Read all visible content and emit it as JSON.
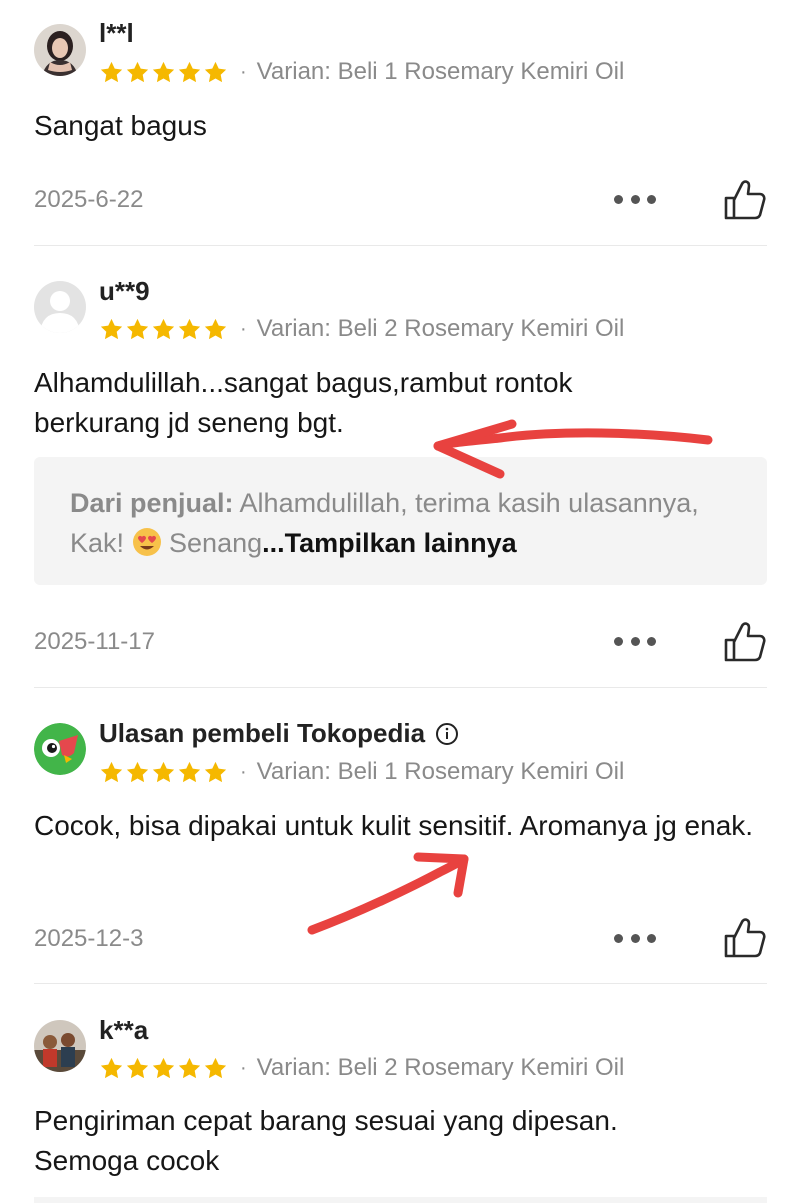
{
  "reviews": [
    {
      "username": "l**l",
      "variant": "Varian: Beli 1 Rosemary Kemiri Oil",
      "rating": 5,
      "text": "Sangat bagus",
      "date": "2025-6-22",
      "avatar": "user-photo-woman"
    },
    {
      "username": "u**9",
      "variant": "Varian: Beli 2 Rosemary Kemiri Oil",
      "rating": 5,
      "text": "Alhamdulillah...sangat bagus,rambut rontok berkurang jd seneng bgt.",
      "date": "2025-11-17",
      "avatar": "default-avatar",
      "seller_reply": {
        "label": "Dari penjual:",
        "text": " Alhamdulillah, terima kasih ulasannya, Kak! ",
        "text_after_emoji": " Senang",
        "emoji": "heart-eyes-emoji",
        "show_more": "...Tampilkan lainnya"
      }
    },
    {
      "username": "Ulasan pembeli Tokopedia",
      "variant": "Varian: Beli 1 Rosemary Kemiri Oil",
      "rating": 5,
      "text": "Cocok, bisa dipakai untuk kulit sensitif. Aromanya jg enak.",
      "date": "2025-12-3",
      "avatar": "tokopedia-logo",
      "info_icon": "info-icon"
    },
    {
      "username": "k**a",
      "variant": "Varian: Beli 2 Rosemary Kemiri Oil",
      "rating": 5,
      "text": "Pengiriman cepat barang sesuai yang dipesan. Semoga cocok",
      "avatar": "user-photo-group"
    }
  ],
  "colors": {
    "star": "#f5b800",
    "muted_text": "#8a8a8a",
    "annotation_arrow": "#e8423f",
    "reply_bg": "#f4f4f4",
    "tokopedia_green": "#42b549"
  },
  "icons": {
    "more": "more-dots-icon",
    "like": "thumbs-up-icon",
    "star": "star-icon"
  }
}
